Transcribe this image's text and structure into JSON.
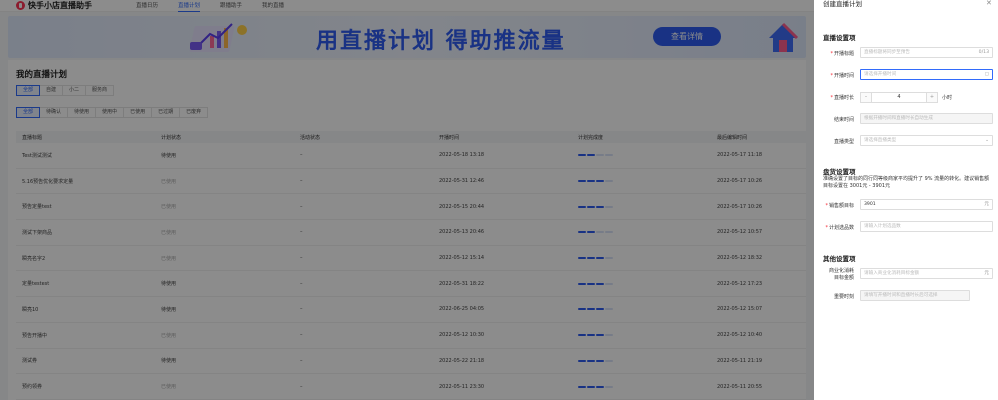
{
  "app": {
    "logo_text": "快手小店直播助手"
  },
  "nav": [
    "直播日历",
    "直播计划",
    "跟播助手",
    "我的直播"
  ],
  "nav_active": 1,
  "banner": {
    "text": "用直播计划 得助推流量",
    "button": "查看详情"
  },
  "page_title": "我的直播计划",
  "type_filters": [
    "全部",
    "自建",
    "小二",
    "服务商"
  ],
  "status_filters": [
    "全部",
    "待确认",
    "待使用",
    "使用中",
    "已使用",
    "已过期",
    "已废弃"
  ],
  "table": {
    "headers": [
      "直播标题",
      "计划状态",
      "活动状态",
      "开播时间",
      "计划完成度",
      "最后编辑时间"
    ],
    "rows": [
      {
        "title": "Test测试测试",
        "status": "待使用",
        "active": true,
        "activity": "–",
        "start": "2022-05-18 13:18",
        "progress": 2,
        "edited": "2022-05-17 11:18"
      },
      {
        "title": "5.16预告优化要求定量",
        "status": "已使用",
        "active": false,
        "activity": "–",
        "start": "2022-05-31 12:46",
        "progress": 3,
        "edited": "2022-05-17 10:26"
      },
      {
        "title": "预告定量test",
        "status": "已使用",
        "active": false,
        "activity": "–",
        "start": "2022-05-15 20:44",
        "progress": 3,
        "edited": "2022-05-17 10:26"
      },
      {
        "title": "测试下架商品",
        "status": "已使用",
        "active": false,
        "activity": "–",
        "start": "2022-05-13 20:46",
        "progress": 2,
        "edited": "2022-05-12 10:57"
      },
      {
        "title": "瞬亮名字2",
        "status": "已使用",
        "active": false,
        "activity": "–",
        "start": "2022-05-12 15:14",
        "progress": 3,
        "edited": "2022-05-12 18:32"
      },
      {
        "title": "定量testest",
        "status": "待使用",
        "active": true,
        "activity": "–",
        "start": "2022-05-31 18:22",
        "progress": 3,
        "edited": "2022-05-12 17:23"
      },
      {
        "title": "瞬亮10",
        "status": "待使用",
        "active": true,
        "activity": "–",
        "start": "2022-06-25 04:05",
        "progress": 3,
        "edited": "2022-05-12 15:07"
      },
      {
        "title": "预告开播中",
        "status": "已使用",
        "active": false,
        "activity": "–",
        "start": "2022-05-12 10:30",
        "progress": 3,
        "edited": "2022-05-12 10:40"
      },
      {
        "title": "测试券",
        "status": "待使用",
        "active": true,
        "activity": "–",
        "start": "2022-05-22 21:18",
        "progress": 3,
        "edited": "2022-05-11 21:19"
      },
      {
        "title": "预约领券",
        "status": "已使用",
        "active": false,
        "activity": "–",
        "start": "2022-05-11 23:30",
        "progress": 3,
        "edited": "2022-05-11 20:55"
      }
    ]
  },
  "drawer": {
    "title": "创建直播计划",
    "section1": "直播设置项",
    "f_title_label": "开播标题",
    "f_title_ph": "直播标题将同步至预告",
    "f_title_count": "0/13",
    "f_time_label": "开播时间",
    "f_time_ph": "请选择开播时间",
    "f_dur_label": "直播时长",
    "f_dur_minus": "–",
    "f_dur_value": "4",
    "f_dur_plus": "+",
    "f_dur_unit": "小时",
    "f_end_label": "结束时间",
    "f_end_ph": "根据开播时间和直播时长自动生成",
    "f_type_label": "直播类型",
    "f_type_ph": "请选择直播类型",
    "section2": "盘货设置项",
    "hint": "准确设置了目标的同行同等级商家平均提升了 9% 流量的转化。建议销售额目标设置在 3001元 - 3901元",
    "f_sales_label": "销售额目标",
    "f_sales_value": "3901",
    "f_sales_unit": "元",
    "f_goods_label": "计划选品数",
    "f_goods_ph": "请输入计划选品数",
    "section3": "其他设置项",
    "f_biz_label1": "商业化消耗",
    "f_biz_label2": "目标金额",
    "f_biz_ph": "请输入商业化消耗目标金额",
    "f_biz_unit": "元",
    "f_key_label": "重要时刻",
    "f_key_ph": "请填写开播时间和直播时长后可选择"
  },
  "colors": {
    "primary": "#326bfb",
    "required": "#f5222d",
    "brand": "#fe3355"
  }
}
